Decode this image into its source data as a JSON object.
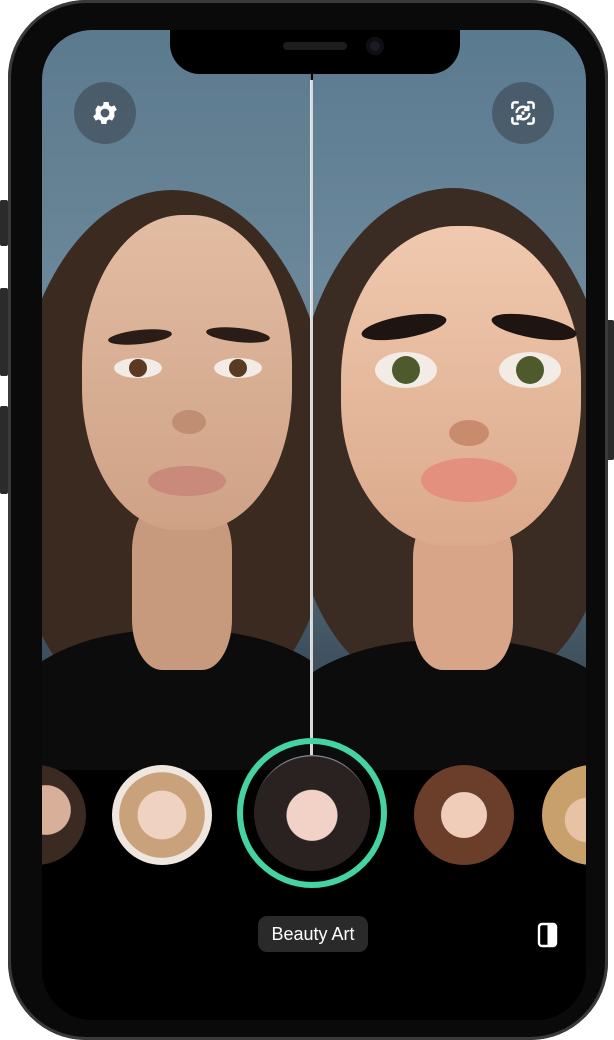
{
  "effect": {
    "selected_label": "Beauty Art"
  },
  "toolbar": {
    "settings_icon": "gear-icon",
    "switch_camera_icon": "camera-switch-icon",
    "compare_icon": "compare-split-icon"
  },
  "colors": {
    "accent": "#45d3a2",
    "pill_bg": "#2a2a2a"
  }
}
